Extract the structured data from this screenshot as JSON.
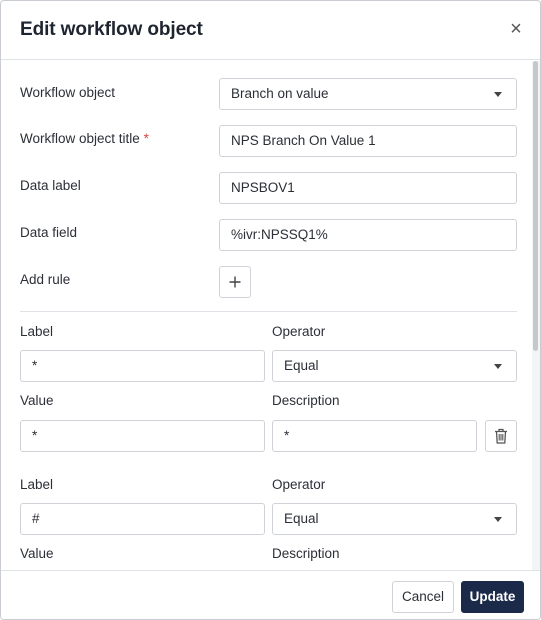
{
  "dialog": {
    "title": "Edit workflow object",
    "close_glyph": "×"
  },
  "form": {
    "workflow_object": {
      "label": "Workflow object",
      "value": "Branch on value"
    },
    "workflow_object_title": {
      "label": "Workflow object title",
      "required_mark": "*",
      "value": "NPS Branch On Value 1"
    },
    "data_label": {
      "label": "Data label",
      "value": "NPSBOV1"
    },
    "data_field": {
      "label": "Data field",
      "value": "%ivr:NPSSQ1%"
    },
    "add_rule": {
      "label": "Add rule",
      "icon": "plus-icon",
      "glyph": "+"
    }
  },
  "rules": [
    {
      "label_caption": "Label",
      "label_value": "*",
      "operator_caption": "Operator",
      "operator_value": "Equal",
      "value_caption": "Value",
      "value_value": "*",
      "description_caption": "Description",
      "description_value": "*",
      "delete_icon": "trash-icon"
    },
    {
      "label_caption": "Label",
      "label_value": "#",
      "operator_caption": "Operator",
      "operator_value": "Equal",
      "value_caption": "Value",
      "description_caption": "Description"
    }
  ],
  "footer": {
    "cancel_label": "Cancel",
    "update_label": "Update"
  },
  "colors": {
    "primary": "#1c2a4a",
    "required": "#d9453c",
    "border": "#cfd3d8"
  }
}
